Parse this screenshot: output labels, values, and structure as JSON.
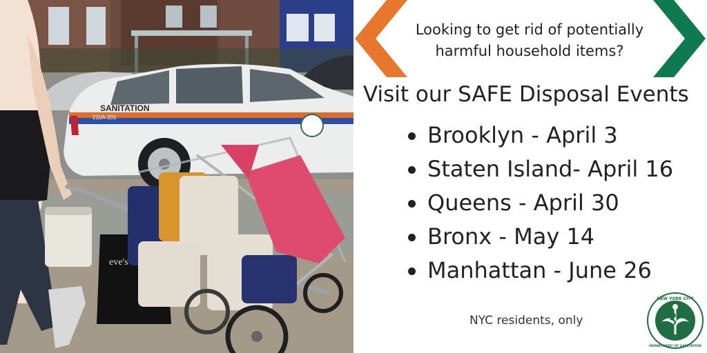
{
  "photo": {
    "vehicle_lettering": "SANITATION",
    "vehicle_id": "210A-201",
    "bag_lettering": "eve's"
  },
  "intro": {
    "line1": "Looking to get rid of potentially",
    "line2": "harmful household items?"
  },
  "headline": "Visit our SAFE Disposal Events",
  "events": [
    "Brooklyn - April 3",
    "Staten Island- April 16",
    "Queens - April 30",
    "Bronx - May 14",
    "Manhattan - June 26"
  ],
  "note": "NYC residents, only",
  "seal": {
    "top_text": "NEW YORK CITY",
    "bottom_text": "DEPARTMENT OF SANITATION"
  },
  "colors": {
    "chevron_left": "#e8772e",
    "chevron_right": "#0f7a4f",
    "seal_green": "#1f6e43",
    "taxi_white": "#eceeee"
  },
  "icons": [
    "chevron-left-icon",
    "chevron-right-icon",
    "dsny-seal-logo"
  ]
}
